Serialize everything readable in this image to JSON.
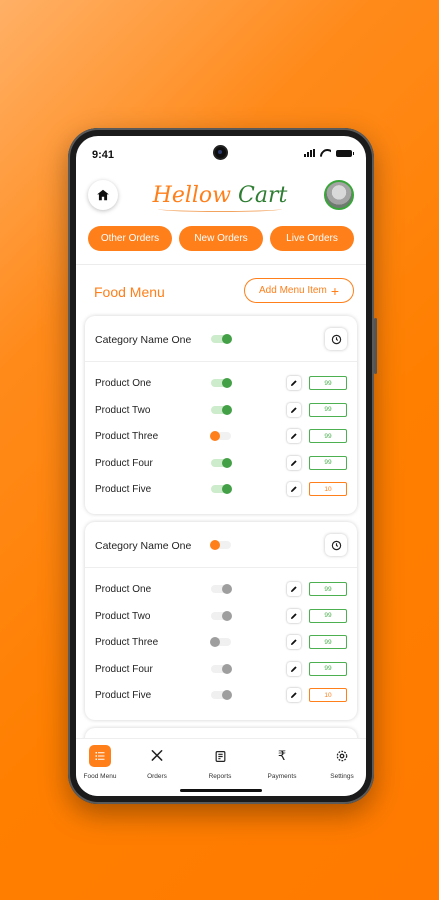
{
  "status": {
    "time": "9:41"
  },
  "header": {
    "logo_part1": "Hellow",
    "logo_part2": "Cart"
  },
  "order_tabs": [
    "Other Orders",
    "New Orders",
    "Live Orders"
  ],
  "section": {
    "title": "Food Menu",
    "add_label": "Add Menu Item",
    "add_icon": "+"
  },
  "categories": [
    {
      "name": "Category Name One",
      "enabled": true,
      "products": [
        {
          "name": "Product One",
          "state": "on",
          "price": "99",
          "price_status": "ok"
        },
        {
          "name": "Product Two",
          "state": "on",
          "price": "99",
          "price_status": "ok"
        },
        {
          "name": "Product Three",
          "state": "off",
          "price": "99",
          "price_status": "ok"
        },
        {
          "name": "Product Four",
          "state": "on",
          "price": "99",
          "price_status": "ok"
        },
        {
          "name": "Product Five",
          "state": "on",
          "price": "10",
          "price_status": "warn"
        }
      ]
    },
    {
      "name": "Category Name One",
      "enabled": false,
      "products": [
        {
          "name": "Product One",
          "state": "disabled-on",
          "price": "99",
          "price_status": "ok"
        },
        {
          "name": "Product Two",
          "state": "disabled-on",
          "price": "99",
          "price_status": "ok"
        },
        {
          "name": "Product Three",
          "state": "disabled-off",
          "price": "99",
          "price_status": "ok"
        },
        {
          "name": "Product Four",
          "state": "disabled-on",
          "price": "99",
          "price_status": "ok"
        },
        {
          "name": "Product Five",
          "state": "disabled-on",
          "price": "10",
          "price_status": "warn"
        }
      ]
    }
  ],
  "bottom_nav": [
    {
      "label": "Food Menu",
      "icon": "list-icon",
      "active": true
    },
    {
      "label": "Orders",
      "icon": "utensils-icon",
      "active": false
    },
    {
      "label": "Reports",
      "icon": "report-icon",
      "active": false
    },
    {
      "label": "Payments",
      "icon": "rupee-icon",
      "active": false
    },
    {
      "label": "Settings",
      "icon": "gear-icon",
      "active": false
    }
  ],
  "colors": {
    "accent": "#ff7f1a",
    "success": "#43a047",
    "disabled": "#9e9e9e"
  }
}
